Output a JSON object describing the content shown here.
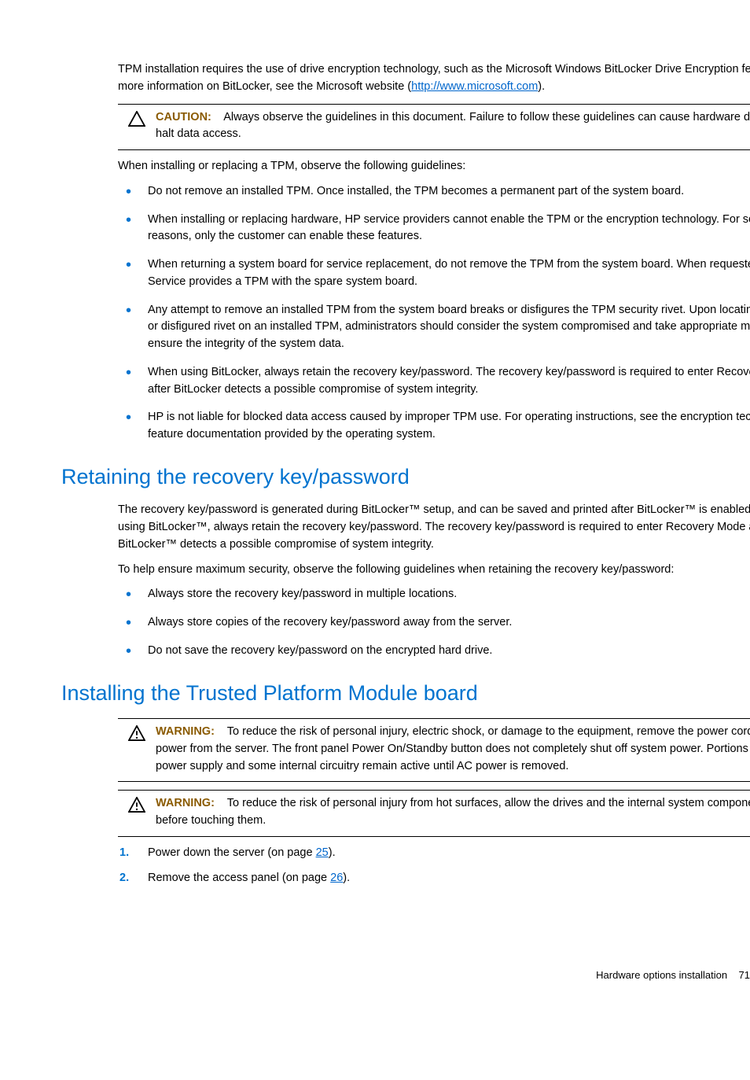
{
  "intro": {
    "text_before_link": "TPM installation requires the use of drive encryption technology, such as the Microsoft Windows BitLocker Drive Encryption feature. For more information on BitLocker, see the Microsoft website (",
    "link_text": "http://www.microsoft.com",
    "text_after_link": ")."
  },
  "caution": {
    "label": "CAUTION:",
    "text": "Always observe the guidelines in this document. Failure to follow these guidelines can cause hardware damage or halt data access."
  },
  "guidelines_intro": "When installing or replacing a TPM, observe the following guidelines:",
  "guidelines": [
    "Do not remove an installed TPM. Once installed, the TPM becomes a permanent part of the system board.",
    "When installing or replacing hardware, HP service providers cannot enable the TPM or the encryption technology. For security reasons, only the customer can enable these features.",
    "When returning a system board for service replacement, do not remove the TPM from the system board. When requested, HP Service provides a TPM with the spare system board.",
    "Any attempt to remove an installed TPM from the system board breaks or disfigures the TPM security rivet. Upon locating a broken or disfigured rivet on an installed TPM, administrators should consider the system compromised and take appropriate measures to ensure the integrity of the system data.",
    "When using BitLocker, always retain the recovery key/password. The recovery key/password is required to enter Recovery Mode after BitLocker detects a possible compromise of system integrity.",
    "HP is not liable for blocked data access caused by improper TPM use. For operating instructions, see the encryption technology feature documentation provided by the operating system."
  ],
  "section1": {
    "title": "Retaining the recovery key/password",
    "p1": "The recovery key/password is generated during BitLocker™ setup, and can be saved and printed after BitLocker™ is enabled. When using BitLocker™, always retain the recovery key/password. The recovery key/password is required to enter Recovery Mode after BitLocker™ detects a possible compromise of system integrity.",
    "p2": "To help ensure maximum security, observe the following guidelines when retaining the recovery key/password:",
    "bullets": [
      "Always store the recovery key/password in multiple locations.",
      "Always store copies of the recovery key/password away from the server.",
      "Do not save the recovery key/password on the encrypted hard drive."
    ]
  },
  "section2": {
    "title": "Installing the Trusted Platform Module board",
    "warning1": {
      "label": "WARNING:",
      "text": "To reduce the risk of personal injury, electric shock, or damage to the equipment, remove the power cord to remove power from the server. The front panel Power On/Standby button does not completely shut off system power. Portions of the power supply and some internal circuitry remain active until AC power is removed."
    },
    "warning2": {
      "label": "WARNING:",
      "text": "To reduce the risk of personal injury from hot surfaces, allow the drives and the internal system components to cool before touching them."
    },
    "steps": [
      {
        "num": "1.",
        "pre": "Power down the server (on page ",
        "link": "25",
        "post": ")."
      },
      {
        "num": "2.",
        "pre": "Remove the access panel (on page ",
        "link": "26",
        "post": ")."
      }
    ]
  },
  "footer": {
    "text": "Hardware options installation",
    "page": "71"
  }
}
